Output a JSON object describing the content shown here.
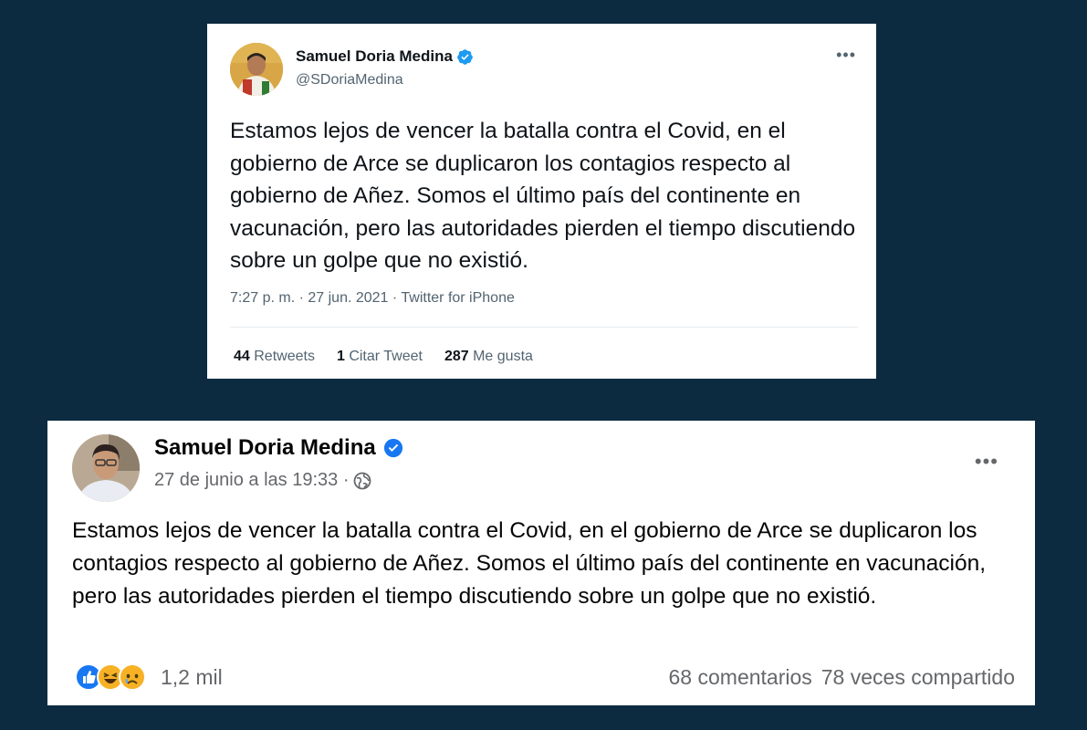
{
  "twitter": {
    "name": "Samuel Doria Medina",
    "handle": "@SDoriaMedina",
    "more_icon": "ellipsis-icon",
    "verified_icon": "verified-badge-icon",
    "text": "Estamos lejos de vencer la batalla contra el Covid, en el gobierno de Arce se duplicaron los contagios respecto al gobierno de Añez. Somos el último país del continente en vacunación, pero las autoridades pierden el tiempo discutiendo sobre un golpe que no existió.",
    "meta": "7:27 p. m. · 27 jun. 2021 · Twitter for iPhone",
    "stats": {
      "retweets_count": "44",
      "retweets_label": "Retweets",
      "quotes_count": "1",
      "quotes_label": "Citar Tweet",
      "likes_count": "287",
      "likes_label": "Me gusta"
    },
    "accent": "#1d9bf0"
  },
  "facebook": {
    "name": "Samuel Doria Medina",
    "date": "27 de junio a las 19:33 ·",
    "globe_icon": "globe-icon",
    "more_icon": "ellipsis-icon",
    "text": "Estamos lejos de vencer la batalla contra el Covid, en el gobierno de Arce se duplicaron los contagios respecto al gobierno de Añez. Somos el último país del continente en vacunación, pero las autoridades pierden el tiempo discutiendo sobre un golpe que no existió.",
    "reactions": {
      "icons": [
        "like-reaction-icon",
        "haha-reaction-icon",
        "sad-reaction-icon"
      ],
      "count": "1,2 mil"
    },
    "comments": "68 comentarios",
    "shares": "78 veces compartido",
    "accent": "#1877f2"
  },
  "background": "#0c2b40"
}
